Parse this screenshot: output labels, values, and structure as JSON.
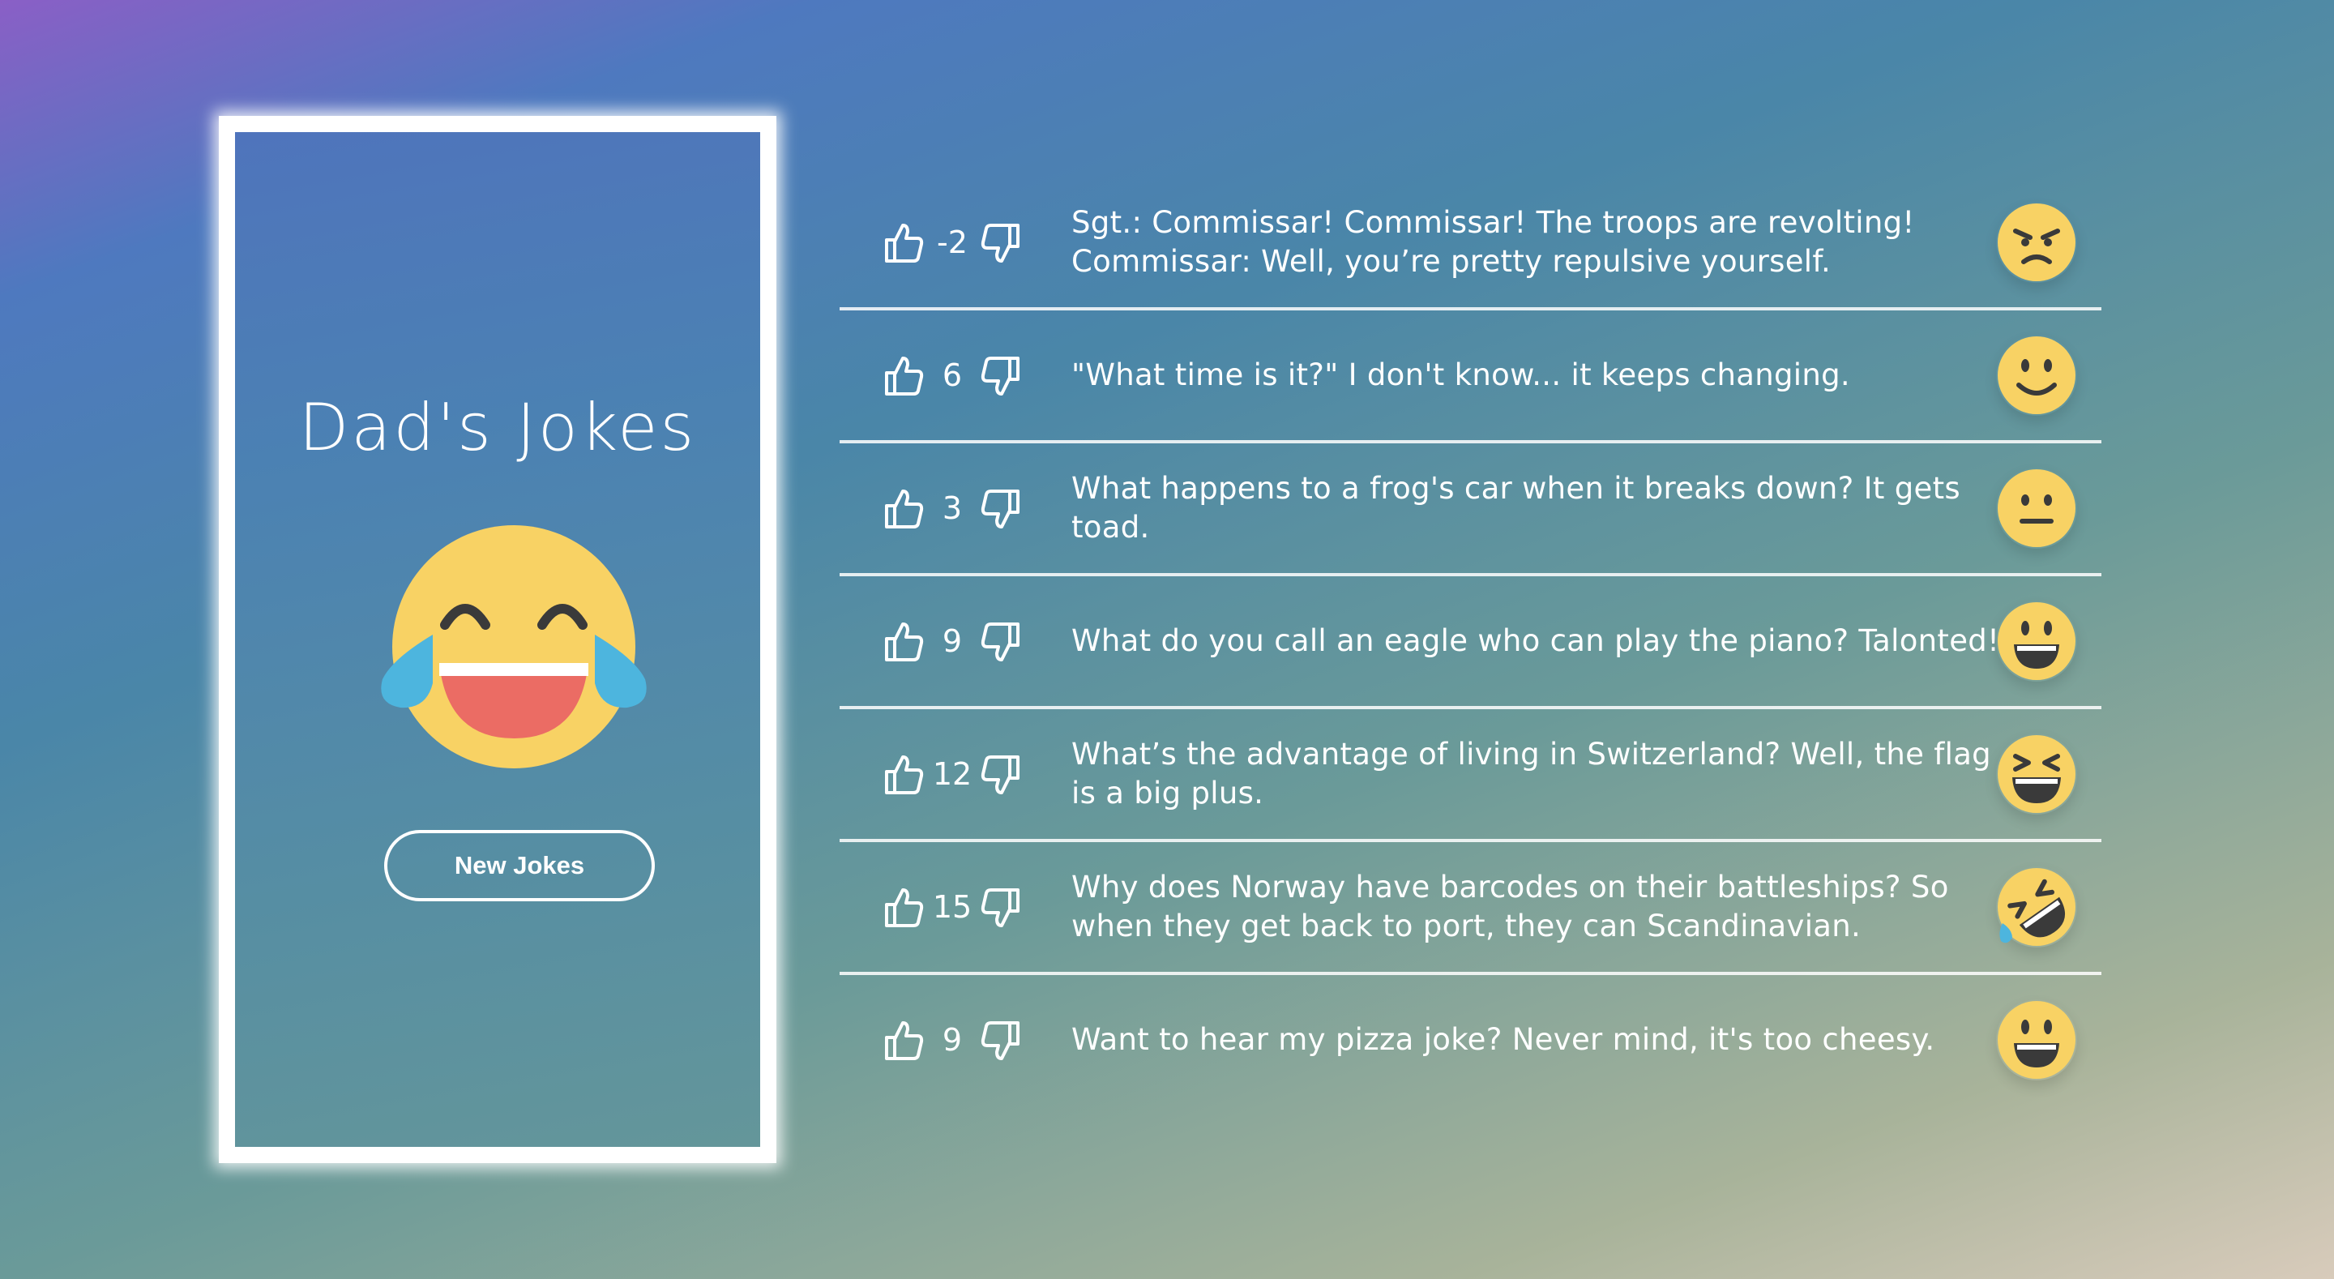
{
  "app": {
    "title": "Dad's Jokes",
    "new_jokes_label": "New Jokes"
  },
  "jokes": [
    {
      "score": "-2",
      "text": "Sgt.: Commissar! Commissar! The troops are revolting! Commissar: Well, you’re pretty repulsive yourself.",
      "emoji": "angry-face-icon"
    },
    {
      "score": "6",
      "text": "\"What time is it?\" I don't know... it keeps changing.",
      "emoji": "slightly-smiling-face-icon"
    },
    {
      "score": "3",
      "text": "What happens to a frog's car when it breaks down? It gets toad.",
      "emoji": "neutral-face-icon"
    },
    {
      "score": "9",
      "text": "What do you call an eagle who can play the piano? Talonted!",
      "emoji": "grinning-face-icon"
    },
    {
      "score": "12",
      "text": "What’s the advantage of living in Switzerland? Well, the flag is a big plus.",
      "emoji": "laughing-squinting-face-icon"
    },
    {
      "score": "15",
      "text": "Why does Norway have barcodes on their battleships? So when they get back to port, they can Scandinavian.",
      "emoji": "rolling-on-floor-laughing-icon"
    },
    {
      "score": "9",
      "text": "Want to hear my pizza joke? Never mind, it's too cheesy.",
      "emoji": "grinning-face-icon"
    }
  ],
  "colors": {
    "emoji_yellow": "#F8D264",
    "tear_blue": "#4DB5DE",
    "mouth_red": "#EB6C64"
  }
}
